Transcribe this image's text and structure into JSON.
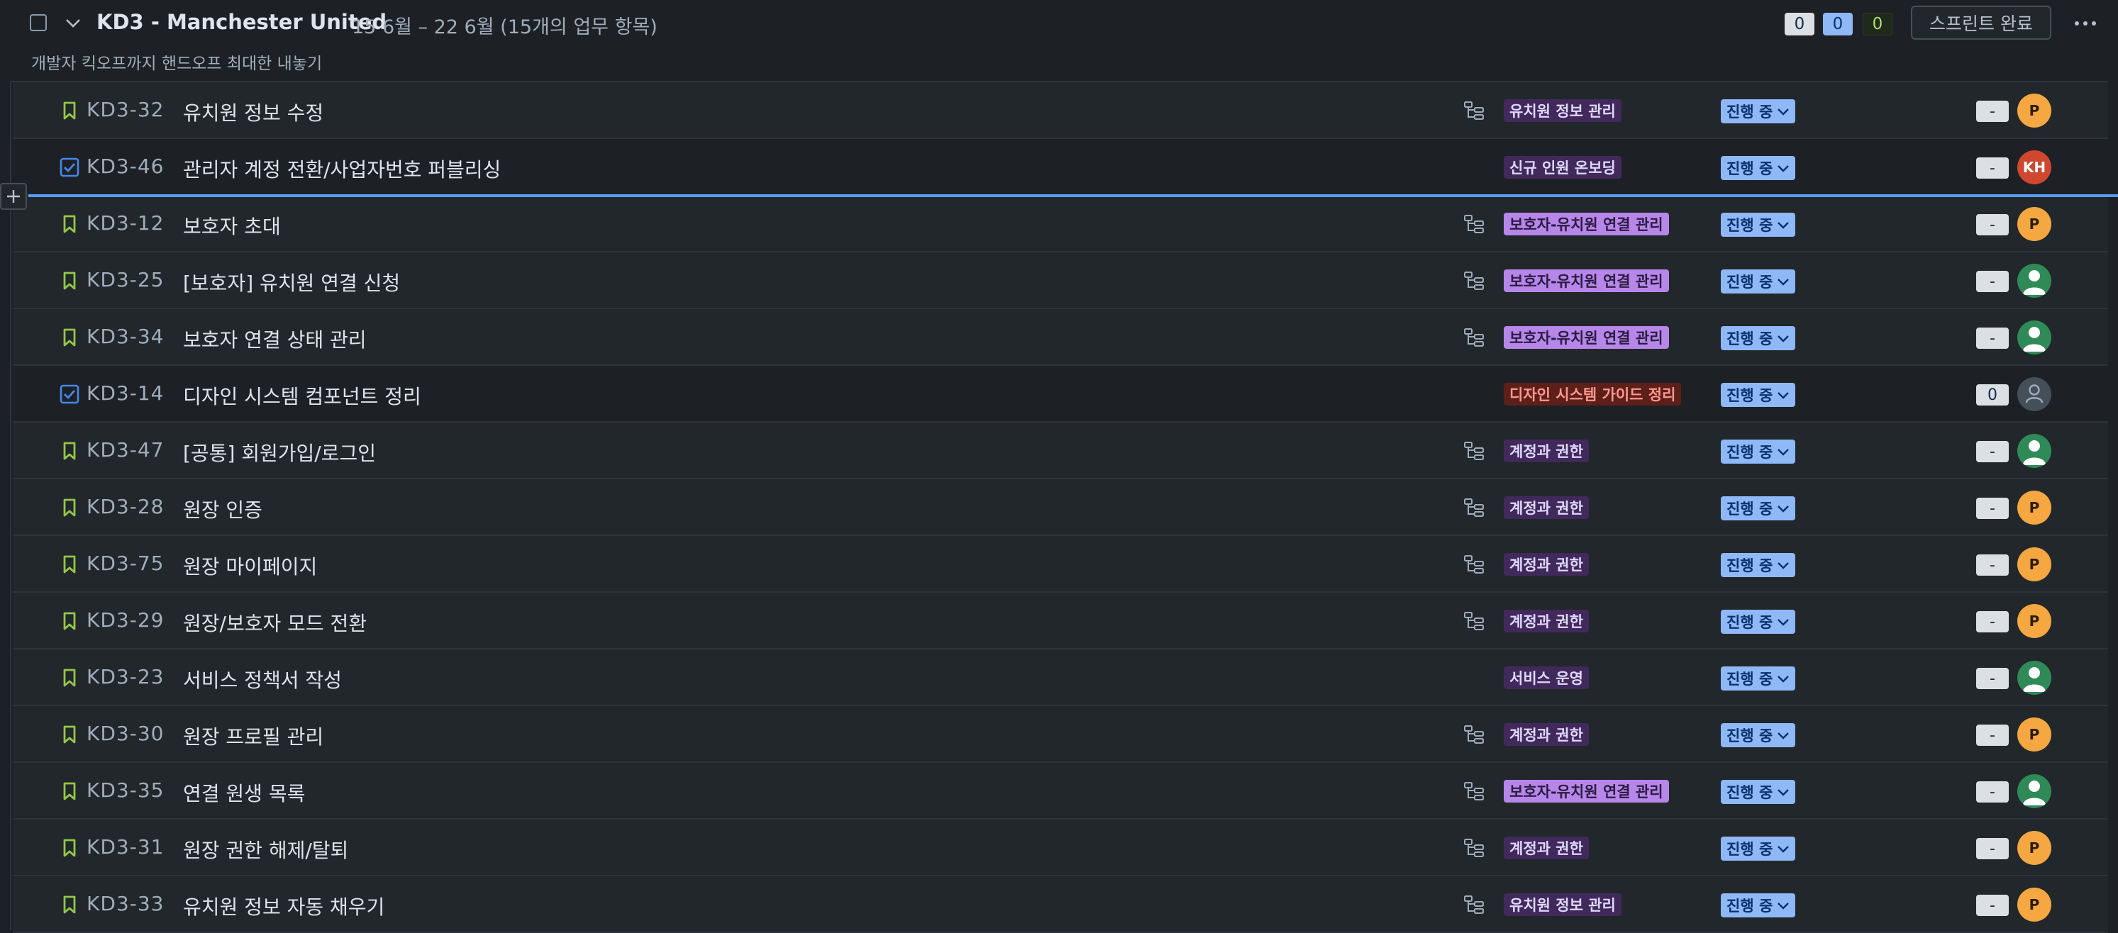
{
  "sprint": {
    "name": "KD3 - Manchester United",
    "dates": "15 6월 – 22 6월 (15개의 업무 항목)",
    "goal": "개발자 킥오프까지 핸드오프 최대한 내놓기",
    "counts": {
      "todo": "0",
      "in_progress": "0",
      "done": "0"
    },
    "complete_label": "스프린트 완료"
  },
  "colors": {
    "story": "#94c748",
    "task": "#4688ec",
    "status_bg": "#8fb8f6",
    "divider": "#579dff"
  },
  "issues": [
    {
      "type": "story",
      "key": "KD3-32",
      "summary": "유치원 정보 수정",
      "has_children": true,
      "epic": "유치원 정보 관리",
      "epic_style": "dark",
      "status": "진행 중",
      "estimate": "-",
      "assignee": "P",
      "avatar": "orange"
    },
    {
      "type": "task",
      "key": "KD3-46",
      "summary": "관리자 계정 전환/사업자번호 퍼블리싱",
      "has_children": false,
      "epic": "신규 인원 온보딩",
      "epic_style": "dark",
      "status": "진행 중",
      "estimate": "-",
      "assignee": "KH",
      "avatar": "red"
    },
    {
      "type": "story",
      "key": "KD3-12",
      "summary": "보호자 초대",
      "has_children": true,
      "epic": "보호자-유치원 연결 관리",
      "epic_style": "light",
      "status": "진행 중",
      "estimate": "-",
      "assignee": "P",
      "avatar": "orange"
    },
    {
      "type": "story",
      "key": "KD3-25",
      "summary": "[보호자] 유치원 연결 신청",
      "has_children": true,
      "epic": "보호자-유치원 연결 관리",
      "epic_style": "light",
      "status": "진행 중",
      "estimate": "-",
      "assignee": "",
      "avatar": "green"
    },
    {
      "type": "story",
      "key": "KD3-34",
      "summary": "보호자 연결 상태 관리",
      "has_children": true,
      "epic": "보호자-유치원 연결 관리",
      "epic_style": "light",
      "status": "진행 중",
      "estimate": "-",
      "assignee": "",
      "avatar": "green"
    },
    {
      "type": "task",
      "key": "KD3-14",
      "summary": "디자인 시스템 컴포넌트 정리",
      "has_children": false,
      "epic": "디자인 시스템 가이드 정리",
      "epic_style": "red",
      "status": "진행 중",
      "estimate": "0",
      "assignee": "",
      "avatar": "gray"
    },
    {
      "type": "story",
      "key": "KD3-47",
      "summary": "[공통] 회원가입/로그인",
      "has_children": true,
      "epic": "계정과 권한",
      "epic_style": "dark",
      "status": "진행 중",
      "estimate": "-",
      "assignee": "",
      "avatar": "green"
    },
    {
      "type": "story",
      "key": "KD3-28",
      "summary": "원장 인증",
      "has_children": true,
      "epic": "계정과 권한",
      "epic_style": "dark",
      "status": "진행 중",
      "estimate": "-",
      "assignee": "P",
      "avatar": "orange"
    },
    {
      "type": "story",
      "key": "KD3-75",
      "summary": "원장 마이페이지",
      "has_children": true,
      "epic": "계정과 권한",
      "epic_style": "dark",
      "status": "진행 중",
      "estimate": "-",
      "assignee": "P",
      "avatar": "orange"
    },
    {
      "type": "story",
      "key": "KD3-29",
      "summary": "원장/보호자 모드 전환",
      "has_children": true,
      "epic": "계정과 권한",
      "epic_style": "dark",
      "status": "진행 중",
      "estimate": "-",
      "assignee": "P",
      "avatar": "orange"
    },
    {
      "type": "story",
      "key": "KD3-23",
      "summary": "서비스 정책서 작성",
      "has_children": false,
      "epic": "서비스 운영",
      "epic_style": "dark",
      "status": "진행 중",
      "estimate": "-",
      "assignee": "",
      "avatar": "green"
    },
    {
      "type": "story",
      "key": "KD3-30",
      "summary": "원장 프로필 관리",
      "has_children": true,
      "epic": "계정과 권한",
      "epic_style": "dark",
      "status": "진행 중",
      "estimate": "-",
      "assignee": "P",
      "avatar": "orange"
    },
    {
      "type": "story",
      "key": "KD3-35",
      "summary": "연결 원생 목록",
      "has_children": true,
      "epic": "보호자-유치원 연결 관리",
      "epic_style": "light",
      "status": "진행 중",
      "estimate": "-",
      "assignee": "",
      "avatar": "green"
    },
    {
      "type": "story",
      "key": "KD3-31",
      "summary": "원장 권한 해제/탈퇴",
      "has_children": true,
      "epic": "계정과 권한",
      "epic_style": "dark",
      "status": "진행 중",
      "estimate": "-",
      "assignee": "P",
      "avatar": "orange"
    },
    {
      "type": "story",
      "key": "KD3-33",
      "summary": "유치원 정보 자동 채우기",
      "has_children": true,
      "epic": "유치원 정보 관리",
      "epic_style": "dark",
      "status": "진행 중",
      "estimate": "-",
      "assignee": "P",
      "avatar": "orange"
    }
  ]
}
